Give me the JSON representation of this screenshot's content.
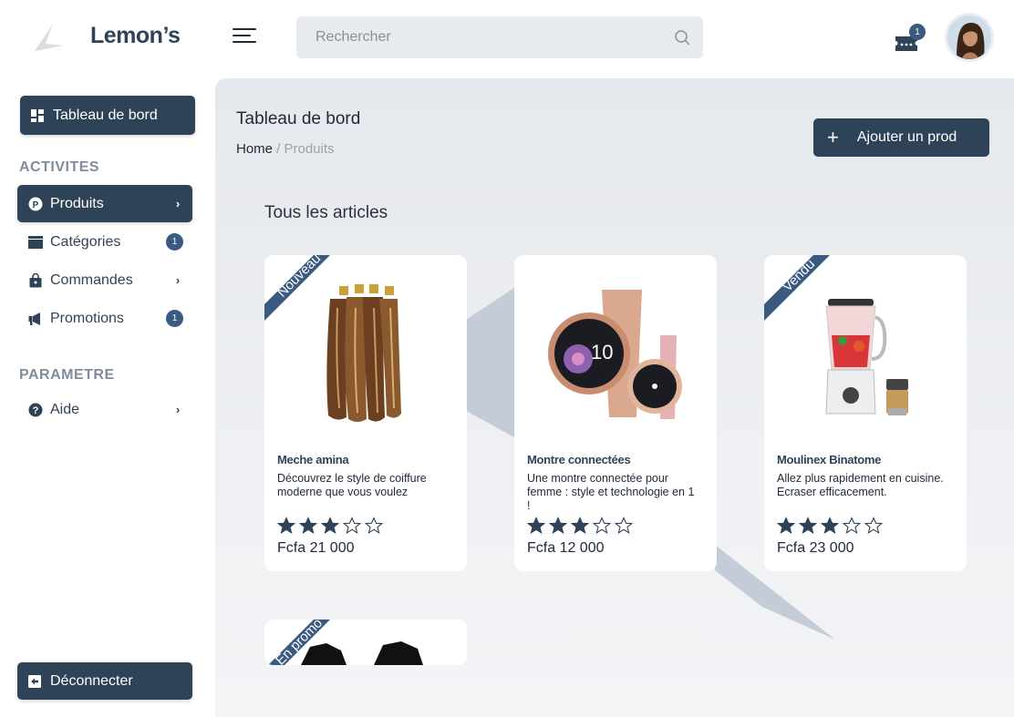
{
  "brand": {
    "name": "Lemon’s"
  },
  "search": {
    "placeholder": "Rechercher"
  },
  "notifications": {
    "count": "1"
  },
  "sidebar": {
    "dashboard_label": "Tableau de bord",
    "section_activities": "ACTIVITES",
    "section_settings": "PARAMETRE",
    "items": [
      {
        "label": "Produits",
        "icon": "p-circle-icon",
        "active": true
      },
      {
        "label": "Catégories",
        "icon": "card-icon",
        "badge": "1"
      },
      {
        "label": "Commandes",
        "icon": "shopping-bag-icon"
      },
      {
        "label": "Promotions",
        "icon": "megaphone-icon",
        "badge": "1"
      }
    ],
    "help_label": "Aide",
    "logout_label": "Déconnecter"
  },
  "main": {
    "title": "Tableau de bord",
    "breadcrumb": {
      "home": "Home",
      "separator": "/",
      "current": "Produits"
    },
    "add_button": "Ajouter un prod",
    "section_title": "Tous les articles"
  },
  "products": [
    {
      "ribbon": "Nouveau",
      "name": "Meche amina",
      "description": "Découvrez le style de coiffure moderne que vous voulez",
      "rating": 3,
      "max_rating": 5,
      "price": "Fcfa 21 000"
    },
    {
      "ribbon": "",
      "name": "Montre connectées",
      "description": "Une montre connectée pour femme : style et technologie en 1 !",
      "rating": 3,
      "max_rating": 5,
      "price": "Fcfa 12 000"
    },
    {
      "ribbon": "Vendu",
      "name": "Moulinex Binatome",
      "description": "Allez plus rapidement en cuisine. Ecraser efficacement.",
      "rating": 3,
      "max_rating": 5,
      "price": "Fcfa 23 000"
    },
    {
      "ribbon": "En promo"
    }
  ],
  "colors": {
    "primary": "#2f4358",
    "badge": "#3b5a80",
    "muted": "#7f8d9e",
    "background": "#e7eaee"
  }
}
